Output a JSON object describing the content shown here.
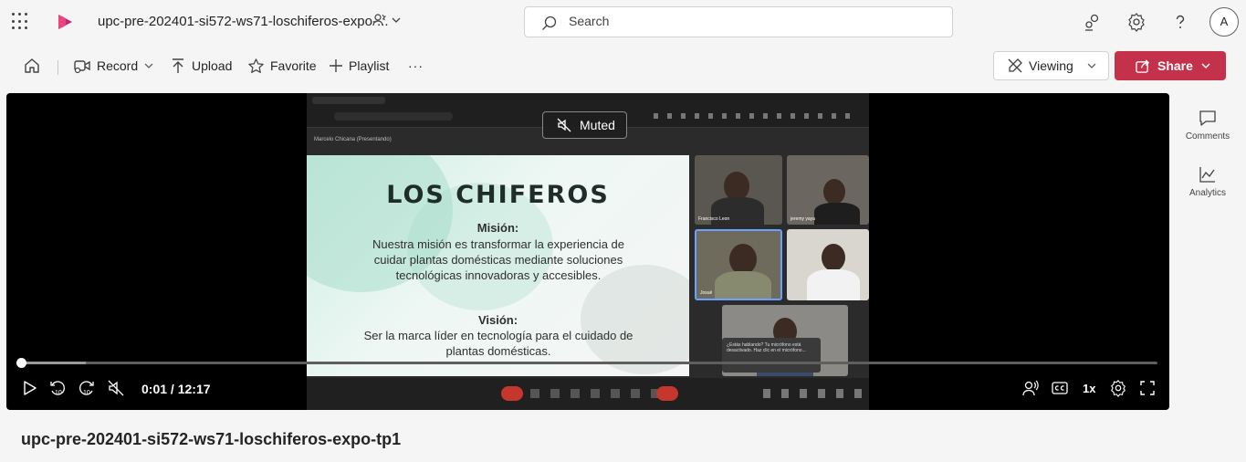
{
  "app": {
    "icon": "stream-app-icon",
    "doc_title": "upc-pre-202401-si572-ws71-loschiferos-expo-...",
    "search_placeholder": "Search",
    "avatar_initial": "A",
    "accent": "#c4314b"
  },
  "toolbar": {
    "record_label": "Record",
    "upload_label": "Upload",
    "favorite_label": "Favorite",
    "playlist_label": "Playlist",
    "more_label": "···",
    "viewing_label": "Viewing",
    "share_label": "Share"
  },
  "player": {
    "muted_label": "Muted",
    "time_current": "0:01",
    "time_separator": " / ",
    "time_total": "12:17",
    "progress_fraction": 0.001,
    "speed_label": "1x",
    "skip_back_label": "10",
    "skip_forward_label": "10"
  },
  "video_frame": {
    "presenter_label": "Marcelo Chicana (Presentando)",
    "slide_title": "LOS CHIFEROS",
    "mission_heading": "Misión:",
    "mission_text": "Nuestra misión es transformar la experiencia de cuidar plantas domésticas mediante soluciones tecnológicas innovadoras y accesibles.",
    "vision_heading": "Visión:",
    "vision_text": "Ser la marca líder en tecnología para el cuidado de plantas domésticas.",
    "participants": [
      "Francisco Leon",
      "jeremy yaya",
      "Josué",
      "",
      ""
    ],
    "toast_text": "¿Estás hablando? Tu micrófono está desactivado. Haz clic en el micrófono..."
  },
  "side_rail": {
    "comments_label": "Comments",
    "analytics_label": "Analytics"
  },
  "video_title": "upc-pre-202401-si572-ws71-loschiferos-expo-tp1"
}
